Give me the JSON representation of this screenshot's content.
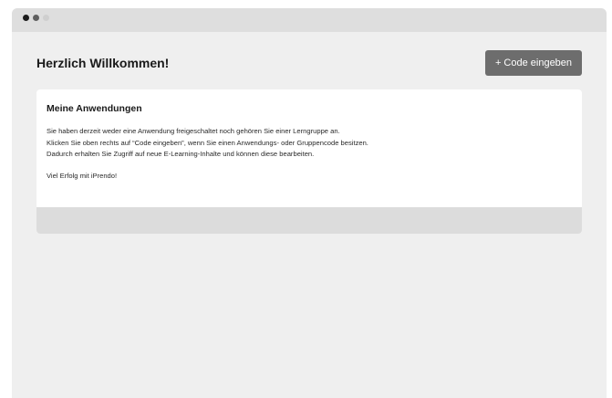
{
  "header": {
    "title": "Herzlich Willkommen!",
    "code_button_label": "+ Code eingeben"
  },
  "applications_card": {
    "title": "Meine Anwendungen",
    "lines": [
      "Sie haben derzeit weder eine Anwendung freigeschaltet noch gehören Sie einer Lerngruppe an.",
      "Klicken Sie oben rechts auf “Code eingeben”, wenn Sie einen Anwendungs- oder Gruppencode besitzen.",
      "Dadurch erhalten Sie Zugriff auf neue E-Learning-Inhalte und können diese bearbeiten."
    ],
    "closing": "Viel Erfolg mit iPrendo!"
  }
}
